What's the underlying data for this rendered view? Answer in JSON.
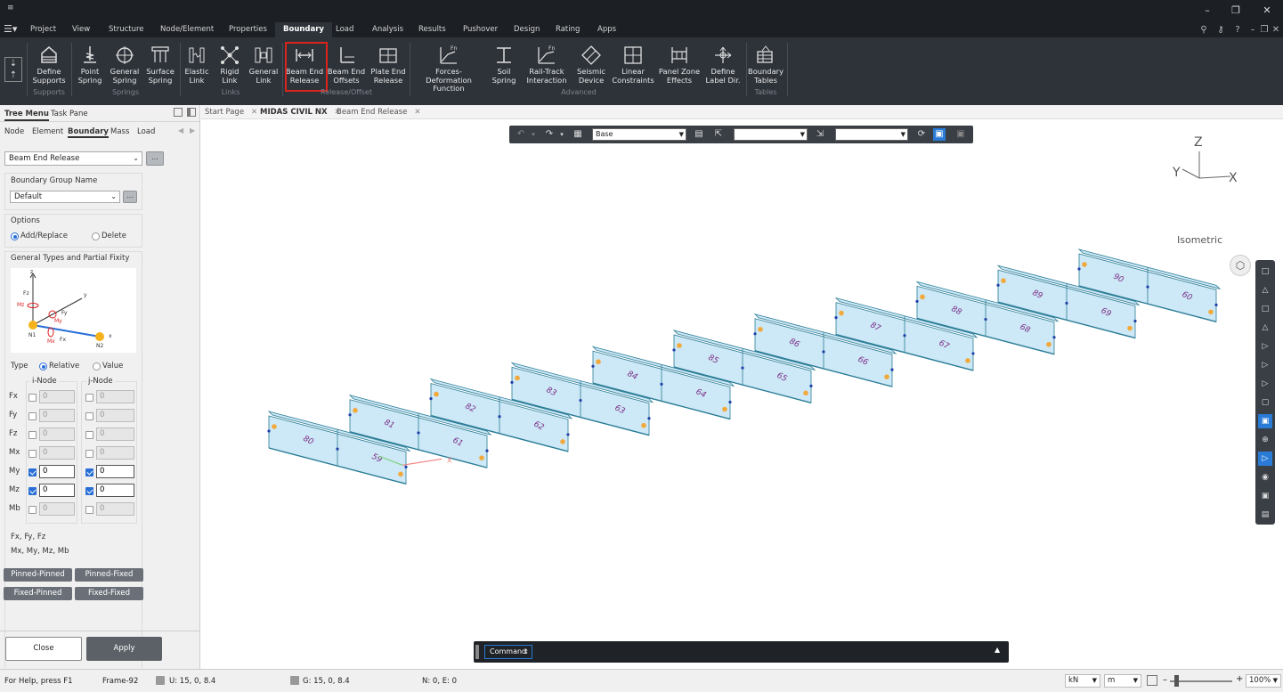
{
  "app": {
    "title": ""
  },
  "menu": {
    "items": [
      {
        "label": "Project"
      },
      {
        "label": "View"
      },
      {
        "label": "Structure"
      },
      {
        "label": "Node/Element"
      },
      {
        "label": "Properties"
      },
      {
        "label": "Boundary"
      },
      {
        "label": "Load"
      },
      {
        "label": "Analysis"
      },
      {
        "label": "Results"
      },
      {
        "label": "Pushover"
      },
      {
        "label": "Design"
      },
      {
        "label": "Rating"
      },
      {
        "label": "Apps"
      }
    ],
    "active": "Boundary"
  },
  "ribbon": {
    "buttons": [
      {
        "label": "Define\nSupports",
        "icon": "define-supports-icon"
      },
      {
        "label": "Point\nSpring",
        "icon": "point-spring-icon"
      },
      {
        "label": "General\nSpring",
        "icon": "general-spring-icon"
      },
      {
        "label": "Surface\nSpring",
        "icon": "surface-spring-icon"
      },
      {
        "label": "Elastic\nLink",
        "icon": "elastic-link-icon"
      },
      {
        "label": "Rigid\nLink",
        "icon": "rigid-link-icon"
      },
      {
        "label": "General\nLink",
        "icon": "general-link-icon"
      },
      {
        "label": "Beam End\nRelease",
        "icon": "beam-end-release-icon"
      },
      {
        "label": "Beam End\nOffsets",
        "icon": "beam-end-offsets-icon"
      },
      {
        "label": "Plate End\nRelease",
        "icon": "plate-end-release-icon"
      },
      {
        "label": "Forces-Deformation\nFunction",
        "icon": "forces-deformation-icon"
      },
      {
        "label": "Soil\nSpring",
        "icon": "soil-spring-icon"
      },
      {
        "label": "Rail-Track\nInteraction",
        "icon": "rail-track-icon"
      },
      {
        "label": "Seismic\nDevice",
        "icon": "seismic-device-icon"
      },
      {
        "label": "Linear\nConstraints",
        "icon": "linear-constraints-icon"
      },
      {
        "label": "Panel Zone\nEffects",
        "icon": "panel-zone-icon"
      },
      {
        "label": "Define\nLabel Dir.",
        "icon": "label-dir-icon"
      },
      {
        "label": "Boundary\nTables",
        "icon": "boundary-tables-icon"
      }
    ],
    "groups": [
      "Supports",
      "Springs",
      "Links",
      "Release/Offset",
      "Advanced",
      "Tables"
    ],
    "icon_fn": "Fn"
  },
  "left": {
    "tabs": [
      "Tree Menu",
      "Task Pane"
    ],
    "subtabs": [
      "Node",
      "Element",
      "Boundary",
      "Mass",
      "Load"
    ],
    "function_select": "Beam End Release",
    "more": "...",
    "group_label": "Boundary Group Name",
    "group_value": "Default",
    "options_label": "Options",
    "opt_add": "Add/Replace",
    "opt_delete": "Delete",
    "gtype_label": "General Types and Partial Fixity",
    "diagram": {
      "z": "z",
      "y": "y",
      "x": "x",
      "fz": "Fz",
      "fy": "Fy",
      "fx": "Fx",
      "mz": "Mz",
      "my": "My",
      "mx": "Mx",
      "n1": "N1",
      "n2": "N2"
    },
    "type_label": "Type",
    "type_relative": "Relative",
    "type_value": "Value",
    "inode": "i-Node",
    "jnode": "j-Node",
    "rows": [
      {
        "name": "Fx",
        "i_checked": false,
        "i_val": "0",
        "j_checked": false,
        "j_val": "0"
      },
      {
        "name": "Fy",
        "i_checked": false,
        "i_val": "0",
        "j_checked": false,
        "j_val": "0"
      },
      {
        "name": "Fz",
        "i_checked": false,
        "i_val": "0",
        "j_checked": false,
        "j_val": "0"
      },
      {
        "name": "Mx",
        "i_checked": false,
        "i_val": "0",
        "j_checked": false,
        "j_val": "0"
      },
      {
        "name": "My",
        "i_checked": true,
        "i_val": "0",
        "j_checked": true,
        "j_val": "0"
      },
      {
        "name": "Mz",
        "i_checked": true,
        "i_val": "0",
        "j_checked": true,
        "j_val": "0"
      },
      {
        "name": "Mb",
        "i_checked": false,
        "i_val": "0",
        "j_checked": false,
        "j_val": "0"
      }
    ],
    "legend1": "Fx, Fy, Fz",
    "legend2": "Mx, My, Mz, Mb",
    "presets": [
      "Pinned-Pinned",
      "Pinned-Fixed",
      "Fixed-Pinned",
      "Fixed-Fixed"
    ],
    "close": "Close",
    "apply": "Apply"
  },
  "doctabs": [
    {
      "label": "Start Page",
      "active": false
    },
    {
      "label": "MIDAS CIVIL NX",
      "active": true
    },
    {
      "label": "Beam End Release",
      "active": false
    }
  ],
  "viewtool": {
    "select1": "Base",
    "select2": "",
    "select3": ""
  },
  "view": {
    "label": "Isometric",
    "axis_z": "Z",
    "axis_y": "Y",
    "axis_x": "X",
    "origin_x": "X",
    "beams": [
      {
        "a": "80",
        "b": "59"
      },
      {
        "a": "81",
        "b": "61"
      },
      {
        "a": "82",
        "b": "62"
      },
      {
        "a": "83",
        "b": "63"
      },
      {
        "a": "84",
        "b": "64"
      },
      {
        "a": "85",
        "b": "65"
      },
      {
        "a": "86",
        "b": "66"
      },
      {
        "a": "87",
        "b": "67"
      },
      {
        "a": "88",
        "b": "68"
      },
      {
        "a": "89",
        "b": "69"
      },
      {
        "a": "90",
        "b": "60"
      }
    ],
    "colors": {
      "beam_fill": "#cde8f6",
      "beam_edge": "#2b7d96",
      "label": "#7a2d86",
      "release": "#f2a93b",
      "node": "#1f3fa8"
    }
  },
  "command": {
    "label": "Command"
  },
  "status": {
    "help": "For Help, press F1",
    "frame": "Frame-92",
    "u": "U: 15, 0, 8.4",
    "g": "G: 15, 0, 8.4",
    "ne": "N: 0, E: 0",
    "force_unit": "kN",
    "length_unit": "m",
    "zoom": "100%"
  }
}
